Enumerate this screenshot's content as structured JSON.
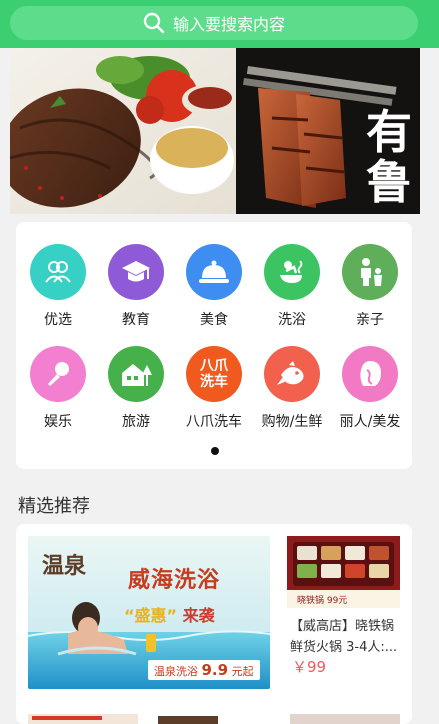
{
  "search": {
    "placeholder": "输入要搜索内容",
    "icon": "search-icon"
  },
  "banner": {
    "slides": 2,
    "active_slide": 1,
    "brand_text": "有鲁"
  },
  "categories": [
    {
      "label": "优选",
      "icon": "people-icon",
      "color": "#36d1c4"
    },
    {
      "label": "教育",
      "icon": "graduation-cap-icon",
      "color": "#8e5ad8"
    },
    {
      "label": "美食",
      "icon": "food-cloche-icon",
      "color": "#3d8ef0"
    },
    {
      "label": "洗浴",
      "icon": "bath-icon",
      "color": "#3cc463"
    },
    {
      "label": "亲子",
      "icon": "parent-child-icon",
      "color": "#5fae5a"
    },
    {
      "label": "娱乐",
      "icon": "microphone-icon",
      "color": "#f27fcf"
    },
    {
      "label": "旅游",
      "icon": "house-tree-icon",
      "color": "#46b04a"
    },
    {
      "label": "八爪洗车",
      "icon": "car-wash-logo",
      "logo_text": "八爪\n洗车",
      "color": "#f05a1f"
    },
    {
      "label": "购物/生鲜",
      "icon": "fish-icon",
      "color": "#f2604e"
    },
    {
      "label": "丽人/美发",
      "icon": "woman-profile-icon",
      "color": "#f279c4"
    }
  ],
  "section": {
    "title": "精选推荐"
  },
  "ad": {
    "brand": "温泉",
    "title": "威海洗浴",
    "sub_a": "“盛惠”",
    "sub_b": "来袭",
    "price_prefix": "温泉洗浴",
    "price": "9.9",
    "price_suffix": "元起"
  },
  "product": {
    "title": "【威高店】晓铁锅鲜货火锅 3-4人:...",
    "price": "￥99",
    "img_caption": "晓铁锅  99元"
  }
}
